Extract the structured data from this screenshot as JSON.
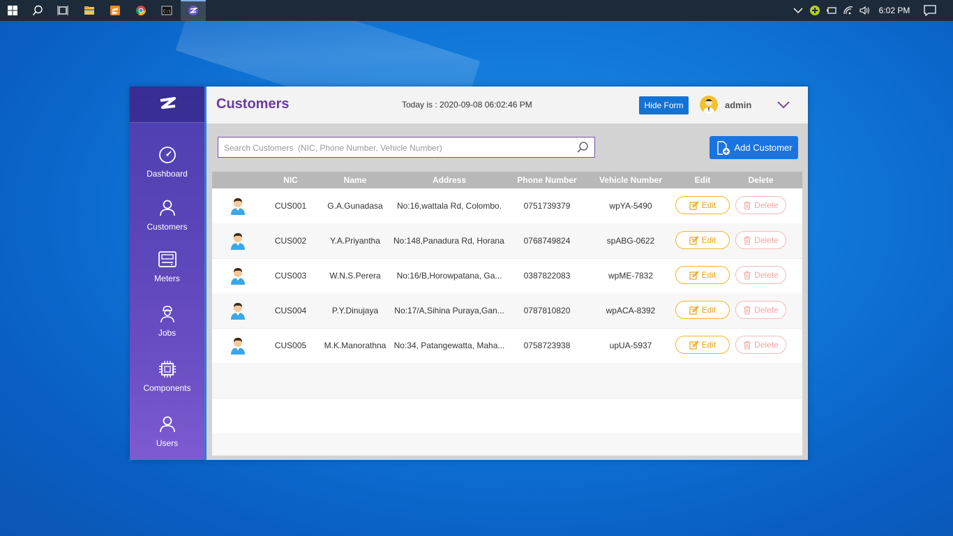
{
  "taskbar": {
    "clock": "6:02 PM"
  },
  "header": {
    "title": "Customers",
    "today_text": "Today is : 2020-09-08 06:02:46 PM",
    "hide_form_label": "Hide Form",
    "username": "admin"
  },
  "sidebar": {
    "items": [
      {
        "label": "Dashboard",
        "icon": "speedometer-icon"
      },
      {
        "label": "Customers",
        "icon": "person-icon"
      },
      {
        "label": "Meters",
        "icon": "meter-icon"
      },
      {
        "label": "Jobs",
        "icon": "worker-icon"
      },
      {
        "label": "Components",
        "icon": "chip-icon"
      },
      {
        "label": "Users",
        "icon": "person-icon"
      }
    ]
  },
  "search": {
    "placeholder": "Search Customers  (NIC, Phone Number, Vehicle Number)"
  },
  "add_button": {
    "label": "Add Customer"
  },
  "table": {
    "headers": [
      "NIC",
      "Name",
      "Address",
      "Phone Number",
      "Vehicle Number",
      "Edit",
      "Delete"
    ],
    "edit_label": "Edit",
    "delete_label": "Delete",
    "rows": [
      {
        "nic": "CUS001",
        "name": "G.A.Gunadasa",
        "address": "No:16,wattala Rd, Colombo.",
        "phone": "0751739379",
        "vehicle": "wpYA-5490"
      },
      {
        "nic": "CUS002",
        "name": "Y.A.Priyantha",
        "address": "No:148,Panadura Rd, Horana.",
        "phone": "0768749824",
        "vehicle": "spABG-0622"
      },
      {
        "nic": "CUS003",
        "name": "W.N.S.Perera",
        "address": "No:16/B,Horowpatana, Ga...",
        "phone": "0387822083",
        "vehicle": "wpME-7832"
      },
      {
        "nic": "CUS004",
        "name": "P.Y.Dinujaya",
        "address": "No:17/A,Sihina Puraya,Gan...",
        "phone": "0787810820",
        "vehicle": "wpACA-8392"
      },
      {
        "nic": "CUS005",
        "name": "M.K.Manorathna",
        "address": "No:34, Patangewatta, Maha...",
        "phone": "0758723938",
        "vehicle": "upUA-5937"
      }
    ]
  },
  "colors": {
    "accent": "#1a74e0",
    "title": "#6a3a9e",
    "edit": "#f0b429",
    "delete": "#f4b9b9",
    "sidebar_top": "#4b3fb1",
    "sidebar_bottom": "#7e5bd0"
  }
}
